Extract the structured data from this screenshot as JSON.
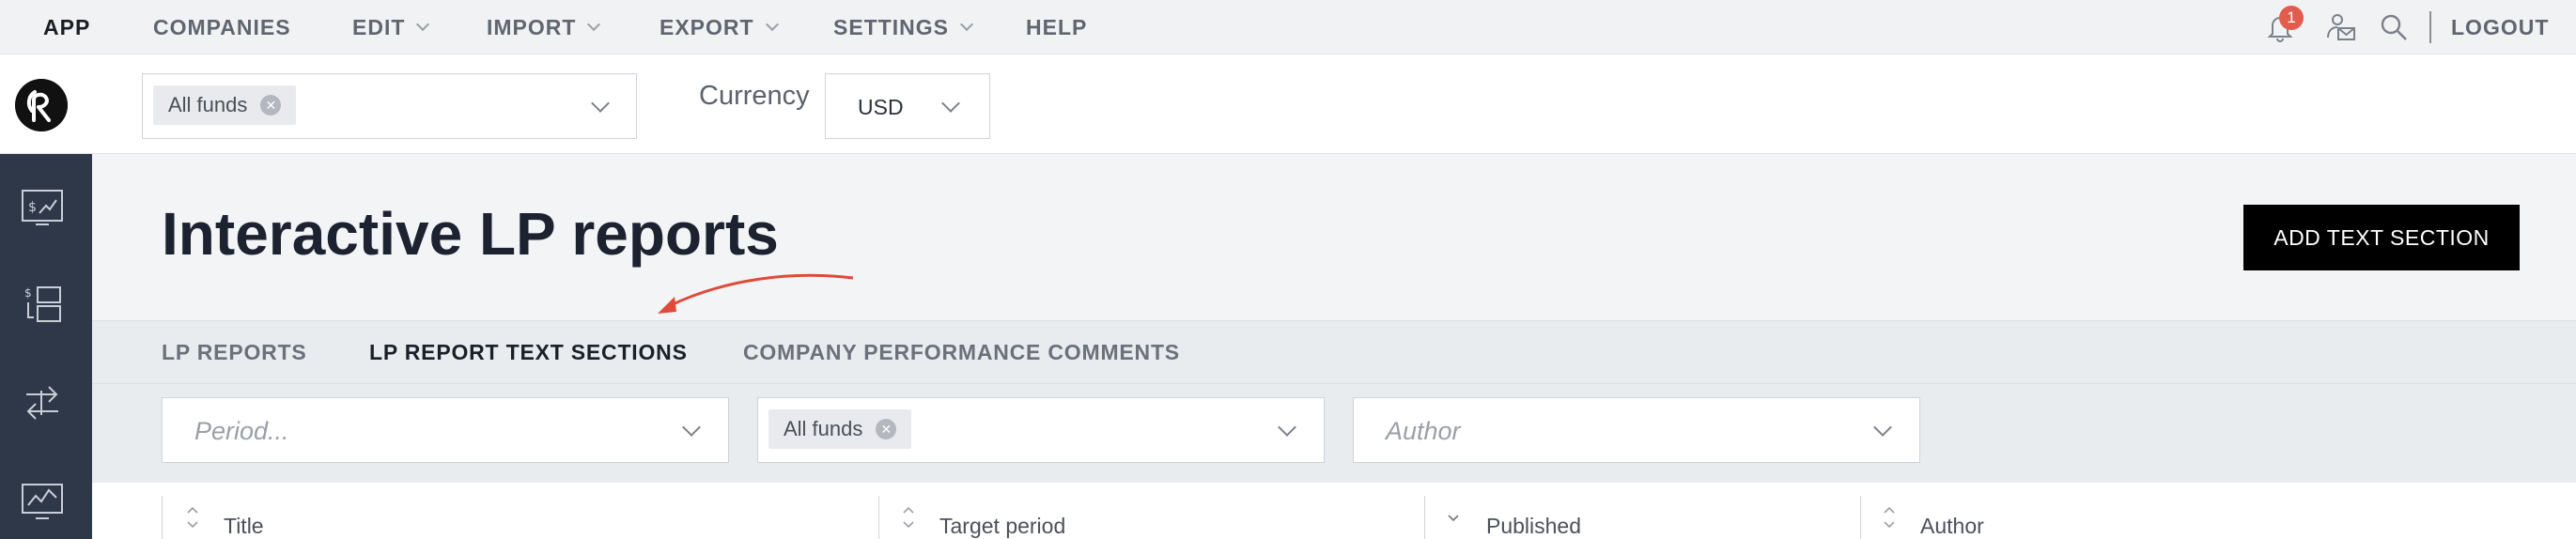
{
  "topnav": {
    "items": [
      {
        "label": "APP",
        "dropdown": false
      },
      {
        "label": "COMPANIES",
        "dropdown": false
      },
      {
        "label": "EDIT",
        "dropdown": true
      },
      {
        "label": "IMPORT",
        "dropdown": true
      },
      {
        "label": "EXPORT",
        "dropdown": true
      },
      {
        "label": "SETTINGS",
        "dropdown": true
      },
      {
        "label": "HELP",
        "dropdown": false
      }
    ],
    "notification_count": "1",
    "logout_label": "LOGOUT",
    "icons": [
      "bell-icon",
      "inbox-person-icon",
      "search-icon"
    ]
  },
  "filterbar": {
    "fund_tag": "All funds",
    "currency_label": "Currency",
    "currency_value": "USD"
  },
  "sidebar": {
    "icons": [
      "dollar-chart-icon",
      "transactions-list-icon",
      "transfer-arrows-icon",
      "line-chart-icon"
    ]
  },
  "page": {
    "title": "Interactive LP reports",
    "add_button": "ADD TEXT SECTION"
  },
  "tabs": [
    {
      "label": "LP REPORTS",
      "active": false
    },
    {
      "label": "LP REPORT TEXT SECTIONS",
      "active": true
    },
    {
      "label": "COMPANY PERFORMANCE COMMENTS",
      "active": false
    }
  ],
  "filters": {
    "period_placeholder": "Period...",
    "fund_tag": "All funds",
    "author_placeholder": "Author"
  },
  "table": {
    "columns": [
      "Title",
      "Target period",
      "Published",
      "Author"
    ]
  },
  "colors": {
    "sidebar": "#2f3848",
    "badge": "#e35b4f",
    "annotation_arrow": "#e04a3a",
    "primary_button": "#000000"
  }
}
